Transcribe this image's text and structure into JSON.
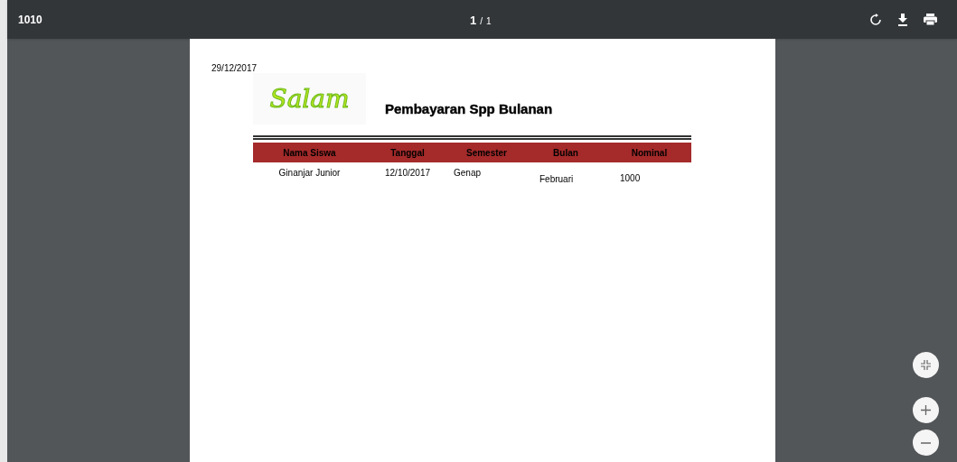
{
  "toolbar": {
    "title": "1010",
    "page_current": "1",
    "page_separator": "/",
    "page_total": "1"
  },
  "document": {
    "date": "29/12/2017",
    "logo": {
      "text": "Salam"
    },
    "title": "Pembayaran Spp Bulanan",
    "table": {
      "columns": [
        "Nama Siswa",
        "Tanggal",
        "Semester",
        "Bulan",
        "Nominal"
      ],
      "rows": [
        [
          "Ginanjar Junior",
          "12/10/2017",
          "Genap",
          "Februari",
          "1000"
        ]
      ]
    }
  }
}
